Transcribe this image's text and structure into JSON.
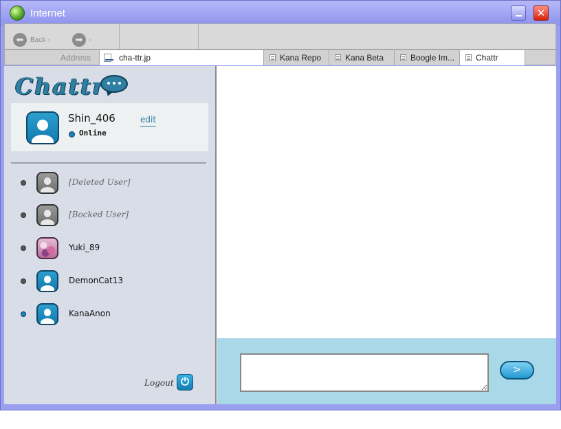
{
  "window": {
    "title": "Internet"
  },
  "toolbar": {
    "back_label": "Back -",
    "forward_label": "-"
  },
  "address": {
    "label": "Address",
    "url": "cha-ttr.jp"
  },
  "tabs": [
    {
      "label": "Kana Repo"
    },
    {
      "label": "Kana Beta"
    },
    {
      "label": "Boogle Im..."
    },
    {
      "label": "Chattr"
    }
  ],
  "app": {
    "logo": "Chattr",
    "user": {
      "name": "Shin_406",
      "status": "Online",
      "edit_label": "edit"
    },
    "contacts": [
      {
        "name": "[Deleted User]",
        "status": "offline"
      },
      {
        "name": "[Bocked User]",
        "status": "offline"
      },
      {
        "name": "Yuki_89",
        "status": "offline"
      },
      {
        "name": "DemonCat13",
        "status": "offline"
      },
      {
        "name": "KanaAnon",
        "status": "online"
      }
    ],
    "logout_label": "Logout",
    "message_input": {
      "value": "",
      "placeholder": ""
    },
    "send_label": ">"
  }
}
